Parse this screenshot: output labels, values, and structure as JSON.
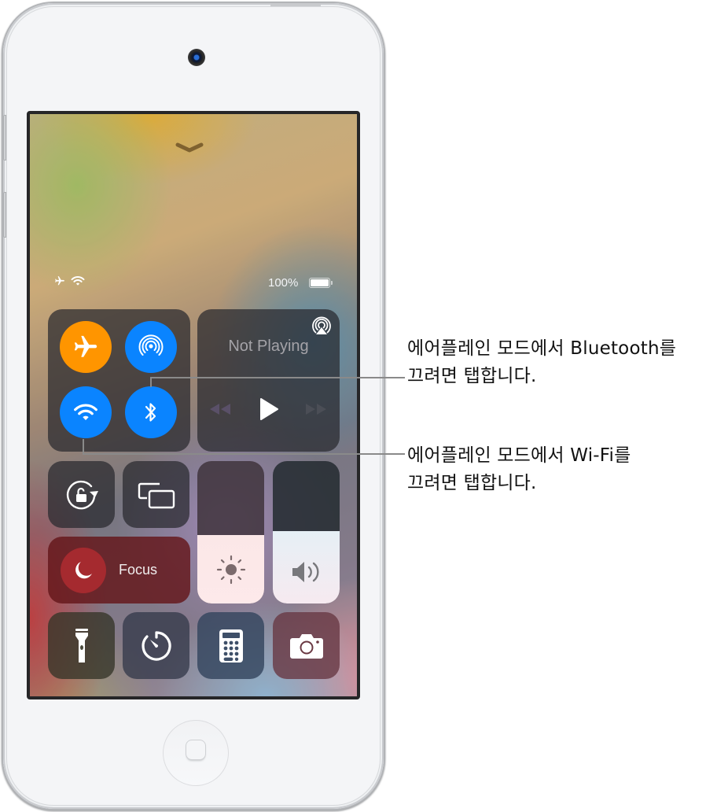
{
  "device": {
    "type": "iPod touch",
    "home_button": "home-button"
  },
  "control_center": {
    "dismiss_chevron": "chevron-down-icon",
    "status_bar": {
      "icons": [
        "airplane-icon",
        "wifi-icon"
      ],
      "battery_percent": "100%",
      "battery_level": 1.0
    },
    "connectivity": {
      "airplane_mode": {
        "icon": "airplane-icon",
        "state": "on",
        "color": "#ff9500"
      },
      "airdrop": {
        "icon": "airdrop-icon",
        "state": "on",
        "color": "#0a84ff"
      },
      "wifi": {
        "icon": "wifi-icon",
        "state": "on",
        "color": "#0a84ff"
      },
      "bluetooth": {
        "icon": "bluetooth-icon",
        "state": "on",
        "color": "#0a84ff"
      }
    },
    "now_playing": {
      "title": "Not Playing",
      "airplay_icon": "airplay-icon",
      "controls": [
        "rewind-icon",
        "play-icon",
        "fast-forward-icon"
      ]
    },
    "orientation_lock": {
      "icon": "rotation-lock-icon"
    },
    "screen_mirroring": {
      "icon": "screen-mirroring-icon"
    },
    "focus": {
      "label": "Focus",
      "icon": "moon-icon",
      "color": "#a52a2f"
    },
    "brightness": {
      "icon": "sun-icon",
      "level": 0.48
    },
    "volume": {
      "icon": "speaker-icon",
      "level": 0.51
    },
    "shortcuts": [
      {
        "name": "flashlight",
        "icon": "flashlight-icon"
      },
      {
        "name": "timer",
        "icon": "timer-icon"
      },
      {
        "name": "calculator",
        "icon": "calculator-icon"
      },
      {
        "name": "camera",
        "icon": "camera-icon"
      }
    ]
  },
  "callouts": {
    "bluetooth": {
      "line1": "에어플레인 모드에서 Bluetooth를",
      "line2": "끄려면 탭합니다."
    },
    "wifi": {
      "line1": "에어플레인 모드에서 Wi-Fi를",
      "line2": "끄려면 탭합니다."
    }
  }
}
